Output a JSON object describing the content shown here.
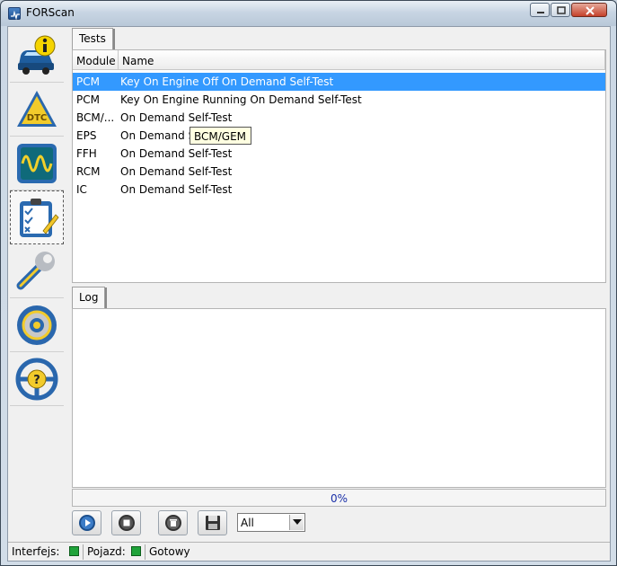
{
  "window": {
    "title": "FORScan"
  },
  "sidebar": {
    "items": [
      {
        "icon": "car-info-icon"
      },
      {
        "icon": "dtc-warning-icon"
      },
      {
        "icon": "oscilloscope-icon"
      },
      {
        "icon": "checklist-icon",
        "active": true
      },
      {
        "icon": "wrench-icon"
      },
      {
        "icon": "gear-icon"
      },
      {
        "icon": "help-steering-wheel-icon"
      }
    ]
  },
  "tests_tab": {
    "label": "Tests",
    "columns": [
      "Module",
      "Name"
    ],
    "rows": [
      {
        "module": "PCM",
        "name": "Key On Engine Off On Demand Self-Test",
        "selected": true
      },
      {
        "module": "PCM",
        "name": "Key On Engine Running On Demand Self-Test"
      },
      {
        "module": "BCM/...",
        "name": "On Demand Self-Test"
      },
      {
        "module": "EPS",
        "name": "On Demand Self-Test"
      },
      {
        "module": "FFH",
        "name": "On Demand Self-Test"
      },
      {
        "module": "RCM",
        "name": "On Demand Self-Test"
      },
      {
        "module": "IC",
        "name": "On Demand Self-Test"
      }
    ],
    "tooltip": "BCM/GEM"
  },
  "log_tab": {
    "label": "Log"
  },
  "progress": {
    "value": 0,
    "text": "0%"
  },
  "toolbar": {
    "filter_selected": "All"
  },
  "statusbar": {
    "interface_label": "Interfejs:",
    "vehicle_label": "Pojazd:",
    "status_text": "Gotowy",
    "led_color": "#1fa33a"
  },
  "colors": {
    "selection": "#3399ff",
    "progress_text": "#1a2fa8"
  }
}
